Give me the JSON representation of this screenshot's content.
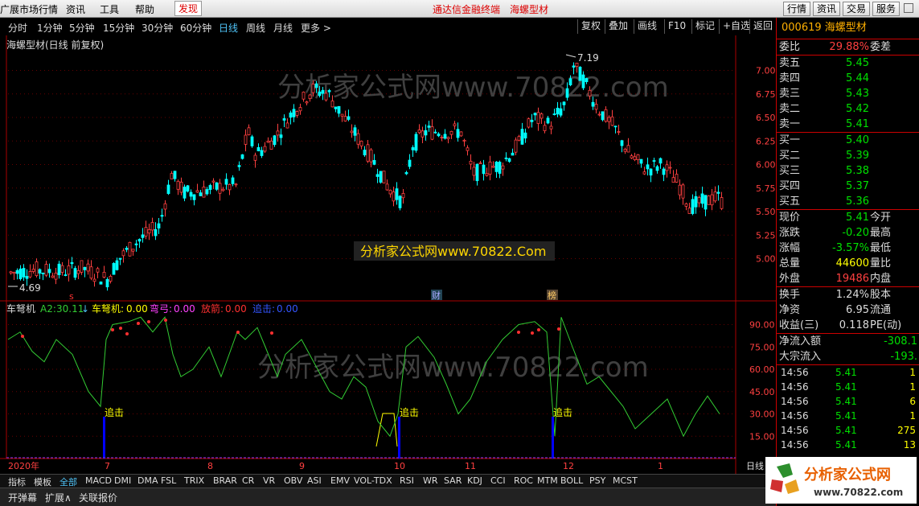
{
  "top_menu": [
    "广展市场行情",
    "资讯",
    "工具",
    "帮助",
    "发现"
  ],
  "top_title": "通达信金融终端",
  "top_stock": "海螺型材",
  "top_right_buttons": [
    "行情",
    "资讯",
    "交易",
    "服务"
  ],
  "periods": [
    "分时",
    "1分钟",
    "5分钟",
    "15分钟",
    "30分钟",
    "60分钟",
    "日线",
    "周线",
    "月线",
    "更多 >"
  ],
  "selected_period": "日线",
  "tools": [
    "复权",
    "叠加",
    "画线",
    "F10",
    "标记",
    "+自选",
    "返回"
  ],
  "chart_title": "海螺型材(日线 前复权)",
  "watermark_text": "分析家公式网www.70822.com",
  "banner_text": "分析家公式网www.70822.Com",
  "main_axis": [
    "7.00",
    "6.75",
    "6.50",
    "6.25",
    "6.00",
    "5.75",
    "5.50",
    "5.25",
    "5.00"
  ],
  "high_label": "7.19",
  "low_label": "4.69",
  "markers": {
    "s": "s",
    "cai": "财",
    "bang": "榜"
  },
  "indicator": {
    "name": "车弩机",
    "a2_label": "A2:",
    "a2_value": "30.11",
    "arrow": "↓",
    "chenuji_label": "车弩机:",
    "chenuji_value": "0.00",
    "qiangong_label": "弯弓:",
    "qiangong_value": "0.00",
    "fangjian_label": "放箭:",
    "fangjian_value": "0.00",
    "zhuiji_label": "追击:",
    "zhuiji_value": "0.00",
    "axis": [
      "90.00",
      "75.00",
      "60.00",
      "45.00",
      "30.00",
      "15.00"
    ],
    "signal_label": "追击"
  },
  "x_axis": [
    "2020年",
    "7",
    "8",
    "9",
    "10",
    "11",
    "12",
    "1"
  ],
  "x_right": "日线",
  "bottom_tabs": [
    "指标",
    "模板",
    "全部",
    "MACD",
    "DMI",
    "DMA",
    "FSL",
    "TRIX",
    "BRAR",
    "CR",
    "VR",
    "OBV",
    "ASI",
    "EMV",
    "VOL-TDX",
    "RSI",
    "WR",
    "SAR",
    "KDJ",
    "CCI",
    "ROC",
    "MTM",
    "BOLL",
    "PSY",
    "MCST"
  ],
  "bottom_tabs2": [
    "开弹幕",
    "扩展∧",
    "关联报价"
  ],
  "stock": {
    "code": "000619",
    "name": "海螺型材"
  },
  "weibi": {
    "label": "委比",
    "value": "29.88%",
    "label2": "委差"
  },
  "sells": [
    {
      "label": "卖五",
      "price": "5.45"
    },
    {
      "label": "卖四",
      "price": "5.44"
    },
    {
      "label": "卖三",
      "price": "5.43"
    },
    {
      "label": "卖二",
      "price": "5.42"
    },
    {
      "label": "卖一",
      "price": "5.41"
    }
  ],
  "buys": [
    {
      "label": "买一",
      "price": "5.40"
    },
    {
      "label": "买二",
      "price": "5.39"
    },
    {
      "label": "买三",
      "price": "5.38"
    },
    {
      "label": "买四",
      "price": "5.37"
    },
    {
      "label": "买五",
      "price": "5.36"
    }
  ],
  "quote": [
    {
      "label": "现价",
      "value": "5.41",
      "label2": "今开"
    },
    {
      "label": "涨跌",
      "value": "-0.20",
      "label2": "最高"
    },
    {
      "label": "涨幅",
      "value": "-3.57%",
      "label2": "最低"
    },
    {
      "label": "总量",
      "value": "44600",
      "label2": "量比"
    },
    {
      "label": "外盘",
      "value": "19486",
      "label2": "内盘"
    }
  ],
  "stats": [
    {
      "label": "换手",
      "value": "1.24%",
      "label2": "股本"
    },
    {
      "label": "净资",
      "value": "6.95",
      "label2": "流通"
    },
    {
      "label": "收益(三)",
      "value": "0.118",
      "label2": "PE(动)"
    }
  ],
  "flows": [
    {
      "label": "净流入额",
      "value": "-308.1"
    },
    {
      "label": "大宗流入",
      "value": "-193."
    }
  ],
  "ticks": [
    {
      "time": "14:56",
      "price": "5.41",
      "vol": "1"
    },
    {
      "time": "14:56",
      "price": "5.41",
      "vol": "1"
    },
    {
      "time": "14:56",
      "price": "5.41",
      "vol": "6"
    },
    {
      "time": "14:56",
      "price": "5.41",
      "vol": "1"
    },
    {
      "time": "14:56",
      "price": "5.41",
      "vol": "275"
    },
    {
      "time": "14:56",
      "price": "5.41",
      "vol": "13"
    }
  ],
  "logo_text": "分析家公式网",
  "logo_url": "www.70822.com",
  "colors": {
    "up": "#ff4040",
    "down": "#00ffff",
    "signal": "#0000ff",
    "line": "#33cc33"
  }
}
